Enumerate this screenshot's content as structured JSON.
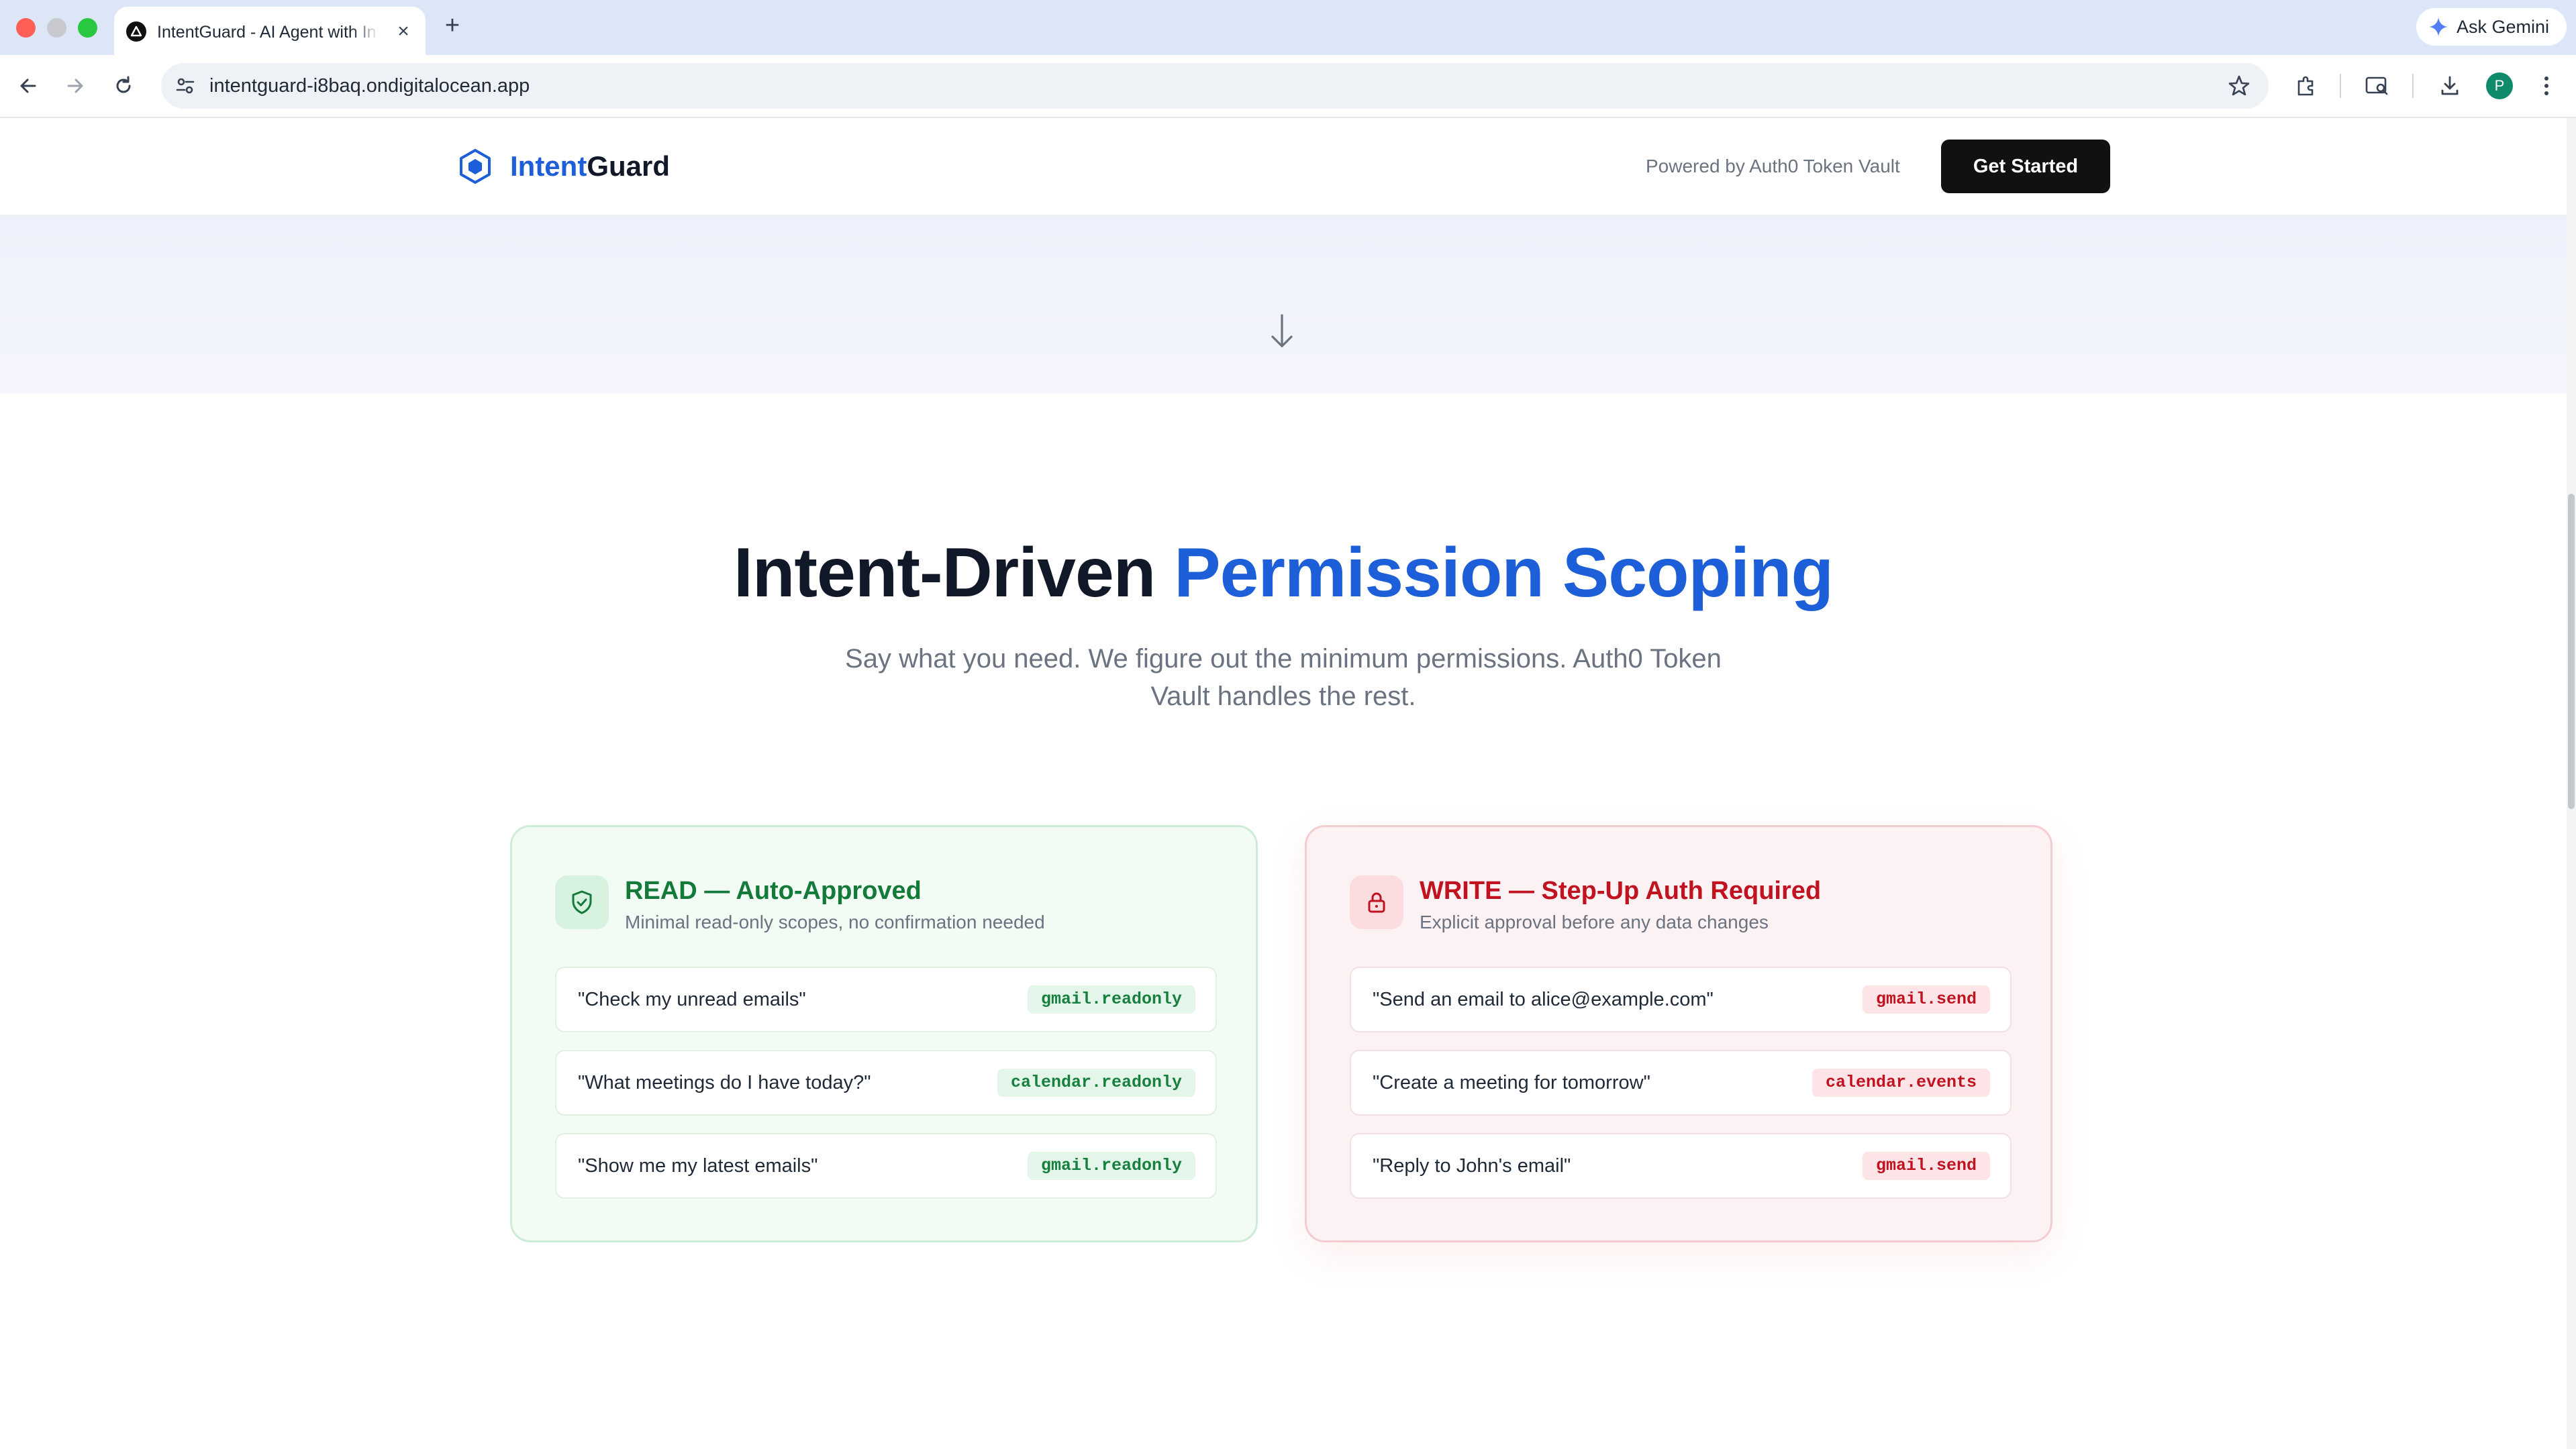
{
  "browser": {
    "tab_title": "IntentGuard - AI Agent with Intent-Driven Permissions",
    "new_tab_symbol": "+",
    "close_symbol": "×",
    "ask_gemini_label": "Ask Gemini",
    "url": "intentguard-i8baq.ondigitalocean.app",
    "profile_initial": "P",
    "traffic_colors": {
      "close": "#ff5f57",
      "minimize": "#c7c9cf",
      "maximize": "#28c840"
    }
  },
  "header": {
    "logo_part1": "Intent",
    "logo_part2": "Guard",
    "powered_by": "Powered by Auth0 Token Vault",
    "cta_label": "Get Started",
    "accent_color": "#1d5fd8"
  },
  "hero": {
    "title_part1": "Intent-Driven",
    "title_part2": "Permission Scoping",
    "subtitle": "Say what you need. We figure out the minimum permissions. Auth0 Token Vault handles the rest."
  },
  "read_card": {
    "title": "READ — Auto-Approved",
    "description": "Minimal read-only scopes, no confirmation needed",
    "icon": "shield-check-icon",
    "color": "#137a3a",
    "rows": [
      {
        "text": "\"Check my unread emails\"",
        "scope": "gmail.readonly"
      },
      {
        "text": "\"What meetings do I have today?\"",
        "scope": "calendar.readonly"
      },
      {
        "text": "\"Show me my latest emails\"",
        "scope": "gmail.readonly"
      }
    ]
  },
  "write_card": {
    "title": "WRITE — Step-Up Auth Required",
    "description": "Explicit approval before any data changes",
    "icon": "lock-icon",
    "color": "#c1121f",
    "rows": [
      {
        "text": "\"Send an email to alice@example.com\"",
        "scope": "gmail.send"
      },
      {
        "text": "\"Create a meeting for tomorrow\"",
        "scope": "calendar.events"
      },
      {
        "text": "\"Reply to John's email\"",
        "scope": "gmail.send"
      }
    ]
  }
}
